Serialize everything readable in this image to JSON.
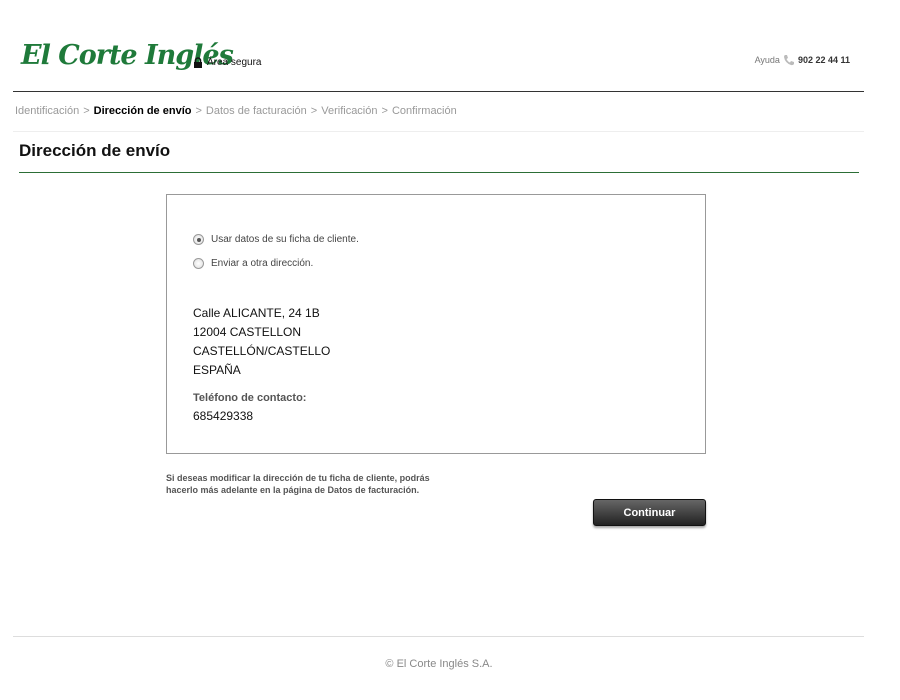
{
  "header": {
    "logo_text": "El Corte Inglés",
    "secure_label": "Área segura",
    "help_label": "Ayuda",
    "help_phone": "902 22 44 11"
  },
  "breadcrumb": {
    "steps": [
      "Identificación",
      "Dirección de envío",
      "Datos de facturación",
      "Verificación",
      "Confirmación"
    ],
    "separator": ">",
    "current_index": 1
  },
  "page": {
    "title": "Dirección de envío"
  },
  "shipping": {
    "options": [
      {
        "label": "Usar datos de su ficha de cliente.",
        "checked": true
      },
      {
        "label": "Enviar a otra dirección.",
        "checked": false
      }
    ],
    "address_lines": [
      "Calle ALICANTE, 24 1B",
      "12004 CASTELLON",
      "CASTELLÓN/CASTELLO",
      "ESPAÑA"
    ],
    "phone_label": "Teléfono de contacto:",
    "phone_value": "685429338"
  },
  "note": {
    "line1": "Si deseas modificar la dirección de tu ficha de cliente, podrás",
    "line2": "hacerlo más adelante en la página de Datos de facturación."
  },
  "actions": {
    "continue_label": "Continuar"
  },
  "footer": {
    "copyright": "© El Corte Inglés S.A."
  },
  "colors": {
    "brand_green": "#1f7a3a",
    "title_rule": "#2c6e36"
  }
}
